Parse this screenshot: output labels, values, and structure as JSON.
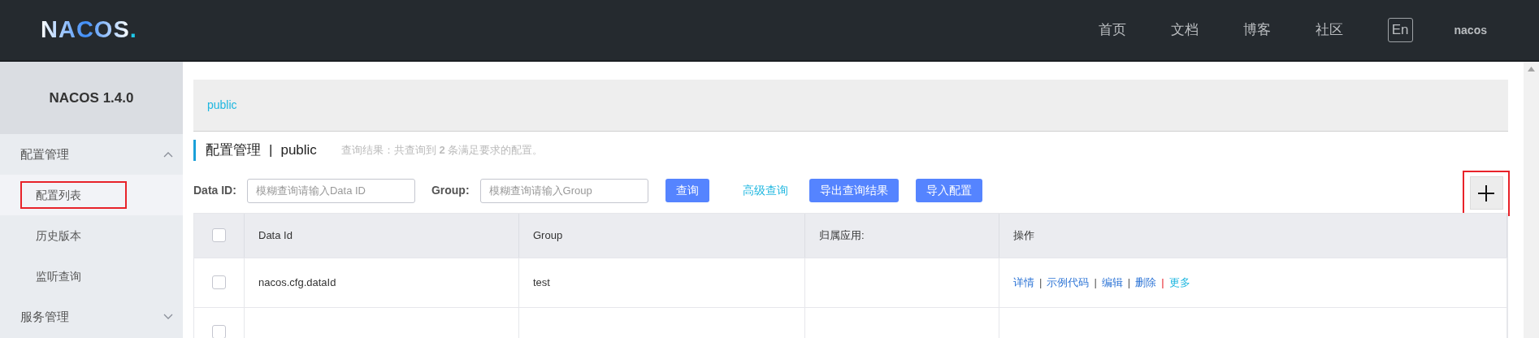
{
  "header": {
    "logo": "NACOS",
    "dot": ".",
    "nav": [
      "首页",
      "文档",
      "博客",
      "社区"
    ],
    "lang": "En",
    "user": "nacos"
  },
  "sidebar": {
    "title": "NACOS 1.4.0",
    "groups": [
      {
        "label": "配置管理",
        "expanded": true,
        "items": [
          {
            "label": "配置列表",
            "selected": true,
            "highlighted": true
          },
          {
            "label": "历史版本",
            "selected": false,
            "highlighted": false
          },
          {
            "label": "监听查询",
            "selected": false,
            "highlighted": false
          }
        ]
      },
      {
        "label": "服务管理",
        "expanded": false
      }
    ]
  },
  "breadcrumb": "public",
  "page_title": {
    "title": "配置管理",
    "separator": "|",
    "namespace": "public",
    "summary": "查询结果：共查询到 **2** 条满足要求的配置。"
  },
  "filters": [
    {
      "label": "Data ID:",
      "placeholder": "模糊查询请输入Data ID"
    },
    {
      "label": "Group:",
      "placeholder": "模糊查询请输入Group"
    }
  ],
  "actions": [
    {
      "kind": "primary",
      "label": "查询"
    },
    {
      "kind": "link",
      "label": "高级查询"
    },
    {
      "kind": "primary",
      "label": "导出查询结果"
    },
    {
      "kind": "primary",
      "label": "导入配置"
    }
  ],
  "add_button": {
    "highlighted": true
  },
  "table": {
    "select_all_checked": false,
    "columns": [
      "Data Id",
      "Group",
      "归属应用:",
      "操作"
    ],
    "rows": [
      {
        "checked": false,
        "data_id": "nacos.cfg.dataId",
        "group": "test",
        "ops": [
          {
            "label": "详情",
            "kind": "link",
            "separator": "|"
          },
          {
            "label": "示例代码",
            "kind": "link",
            "separator": "|"
          },
          {
            "label": "编辑",
            "kind": "link",
            "separator": "|"
          },
          {
            "label": "删除",
            "kind": "link",
            "separator": "|"
          },
          {
            "label": "更多",
            "kind": "more"
          }
        ]
      },
      {
        "checked": false
      }
    ]
  }
}
